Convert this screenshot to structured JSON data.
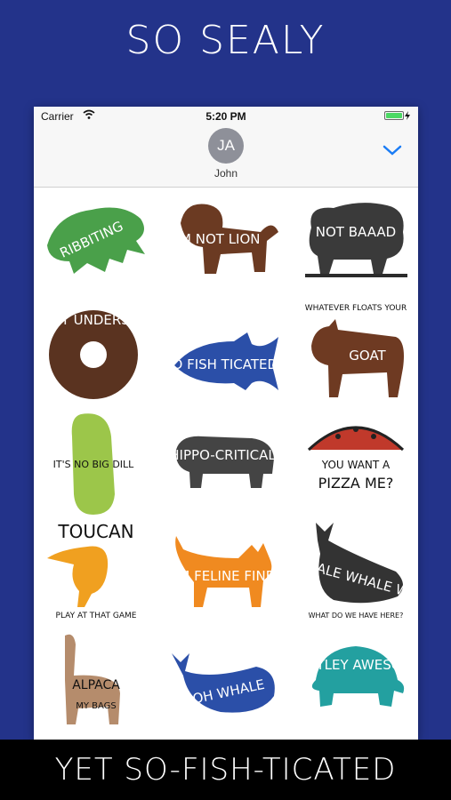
{
  "promo": {
    "headline": "SO SEALY",
    "footer": "YET SO-FISH-TICATED"
  },
  "status_bar": {
    "carrier": "Carrier",
    "time": "5:20 PM",
    "battery_level": 1.0
  },
  "conversation": {
    "avatar_initials": "JA",
    "contact_name": "John"
  },
  "stickers": [
    {
      "name": "frog",
      "text": "RIBBITING",
      "color": "#4aa04a"
    },
    {
      "name": "lion",
      "text": "I'M NOT LION",
      "color": "#6b3a22"
    },
    {
      "name": "sheep",
      "text": "NOT BAAAD",
      "color": "#3a3a3a"
    },
    {
      "name": "donut",
      "text": "DONUT UNDERSTAND",
      "color": "#5a3320"
    },
    {
      "name": "fish",
      "text": "SO FISH TICATED",
      "color": "#2b4fa8"
    },
    {
      "name": "goat",
      "text_top": "WHATEVER FLOATS YOUR",
      "text": "GOAT",
      "color": "#6e3a22"
    },
    {
      "name": "pickle",
      "text": "IT'S NO BIG DILL",
      "color": "#9cc64a"
    },
    {
      "name": "hippo",
      "text": "HIPPO-CRITICAL",
      "color": "#444"
    },
    {
      "name": "pizza",
      "text_top": "YOU WANT A",
      "text": "PIZZA ME?",
      "color": "#c0392b"
    },
    {
      "name": "toucan",
      "text_top": "TOUCAN",
      "text": "PLAY AT THAT GAME",
      "color": "#f0a020"
    },
    {
      "name": "cat",
      "text": "I'M FELINE FINE",
      "color": "#f08a20"
    },
    {
      "name": "whale",
      "text": "WHALE WHALE WHALE",
      "text_bottom": "WHAT DO WE HAVE HERE?",
      "color": "#333"
    },
    {
      "name": "alpaca",
      "text": "ALPACA",
      "text_bottom": "MY BAGS",
      "color": "#b58c6c"
    },
    {
      "name": "whale-blue",
      "text": "OH WHALE",
      "color": "#2b4fa8"
    },
    {
      "name": "turtle",
      "text": "TURTLEY AWESOME",
      "color": "#23a0a0"
    }
  ]
}
